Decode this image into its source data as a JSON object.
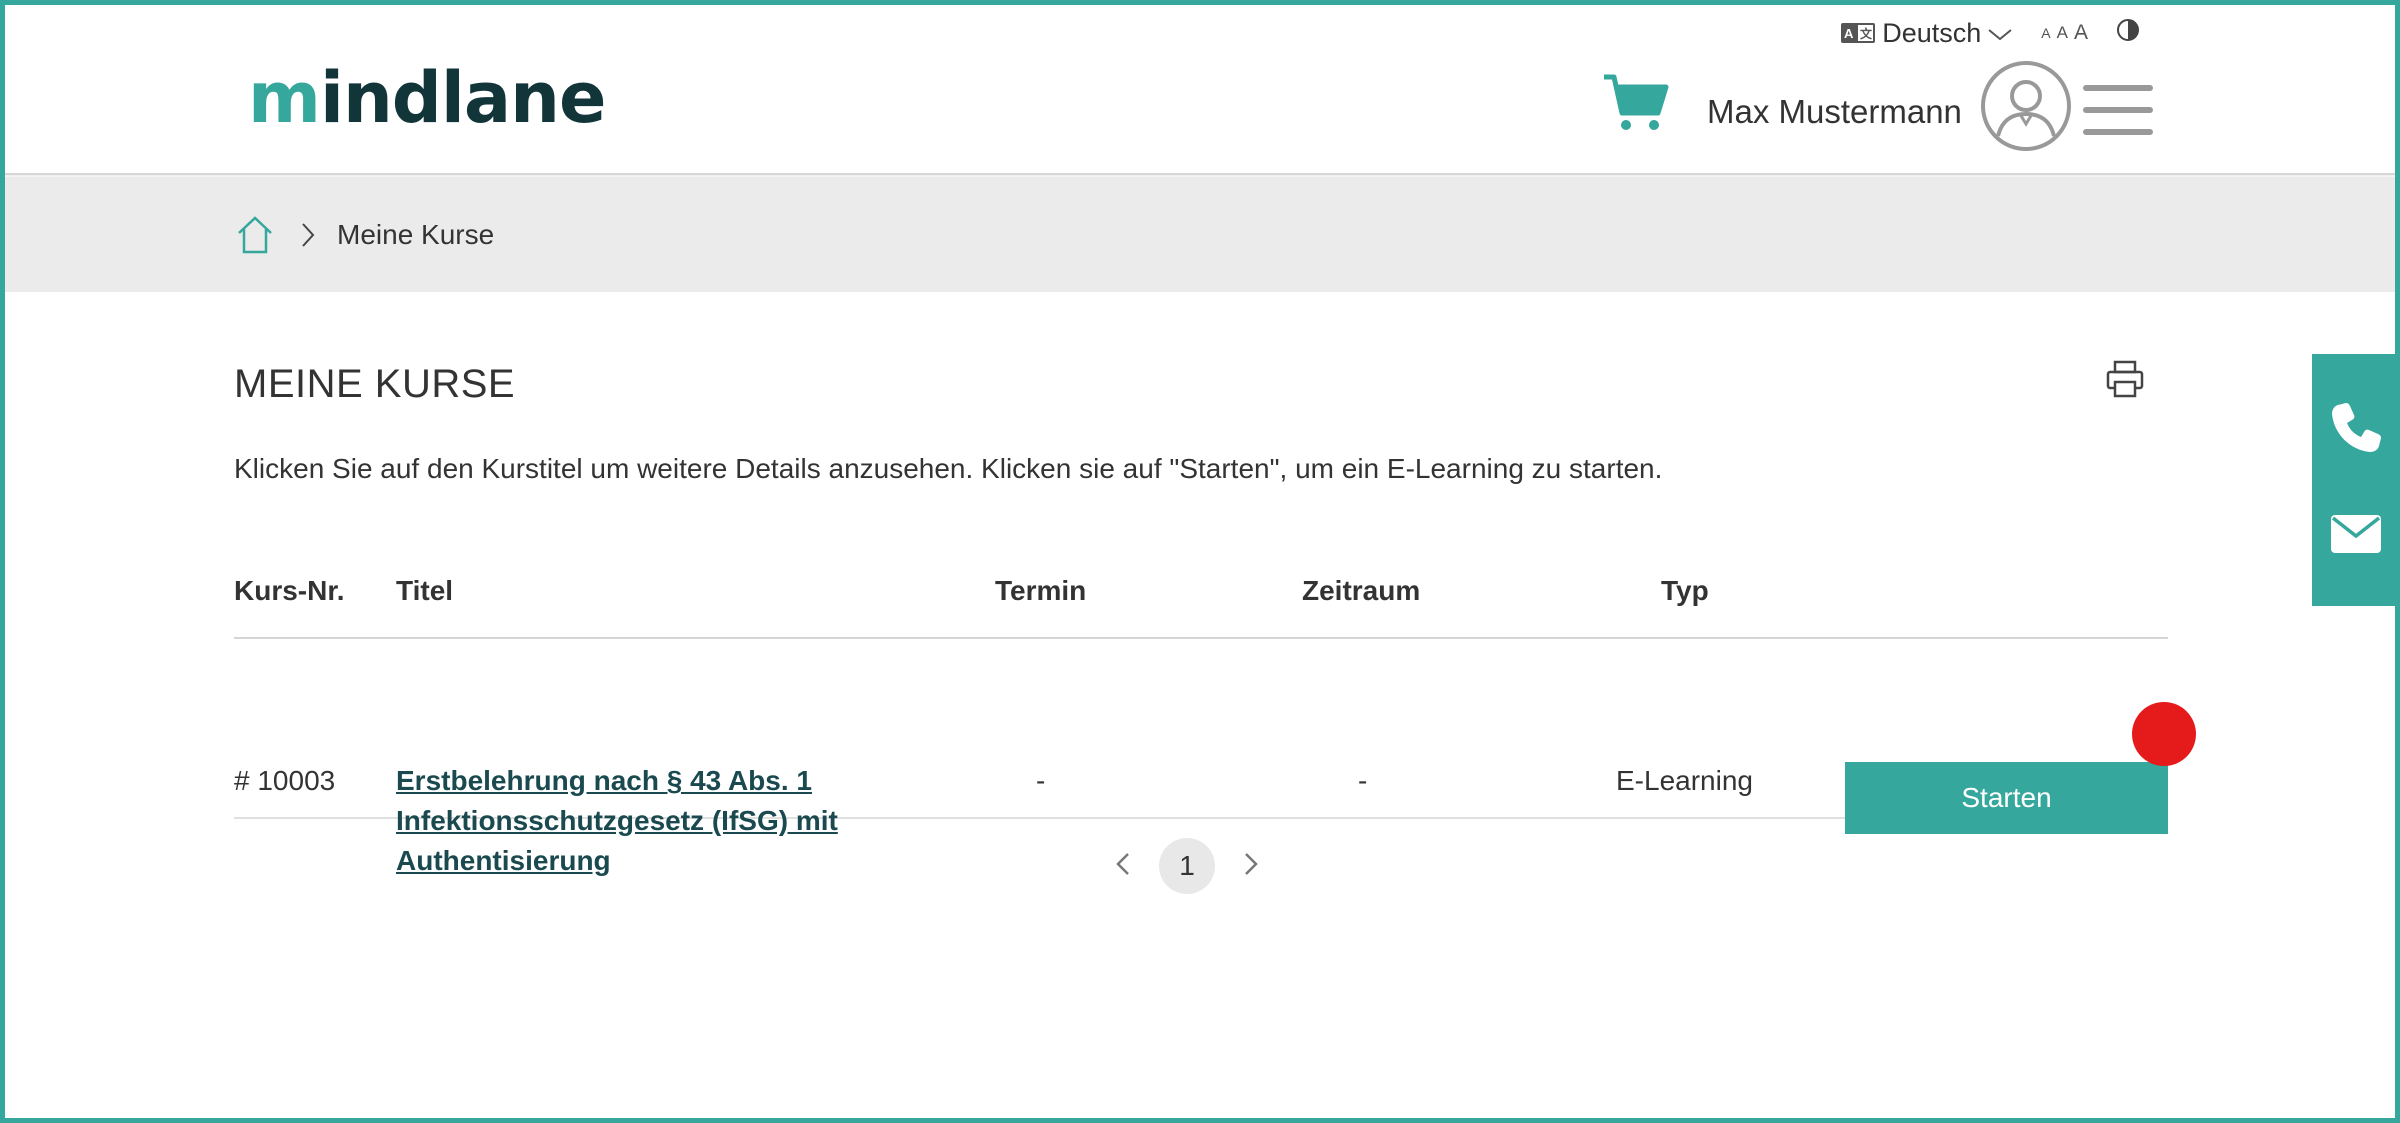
{
  "header": {
    "logo": {
      "first": "m",
      "rest": "indlane"
    },
    "language": "Deutsch",
    "font_size_label": {
      "small": "A",
      "medium": "A",
      "large": "A"
    },
    "username": "Max Mustermann"
  },
  "breadcrumb": {
    "current": "Meine Kurse"
  },
  "main": {
    "title": "MEINE KURSE",
    "intro": "Klicken Sie auf den Kurstitel um weitere Details anzusehen. Klicken sie auf \"Starten\", um ein E-Learning zu starten.",
    "table": {
      "headers": {
        "nr": "Kurs-Nr.",
        "title": "Titel",
        "date": "Termin",
        "period": "Zeitraum",
        "type": "Typ"
      },
      "rows": [
        {
          "nr": "# 10003",
          "title": "Erstbelehrung nach § 43 Abs. 1 Infektionsschutzgesetz (IfSG) mit Authentisierung",
          "date": "-",
          "period": "-",
          "type": "E-Learning",
          "action": "Starten"
        }
      ]
    },
    "pagination": {
      "current_page": "1"
    }
  },
  "colors": {
    "accent": "#35a79c",
    "logo_dark": "#12353a",
    "cursor": "#e51a1a"
  },
  "icons": [
    "language-icon",
    "chevron-down-icon",
    "contrast-icon",
    "cart-icon",
    "avatar-icon",
    "hamburger-menu-icon",
    "home-icon",
    "chevron-right-icon",
    "print-icon",
    "phone-icon",
    "mail-icon",
    "chevron-left-icon"
  ]
}
